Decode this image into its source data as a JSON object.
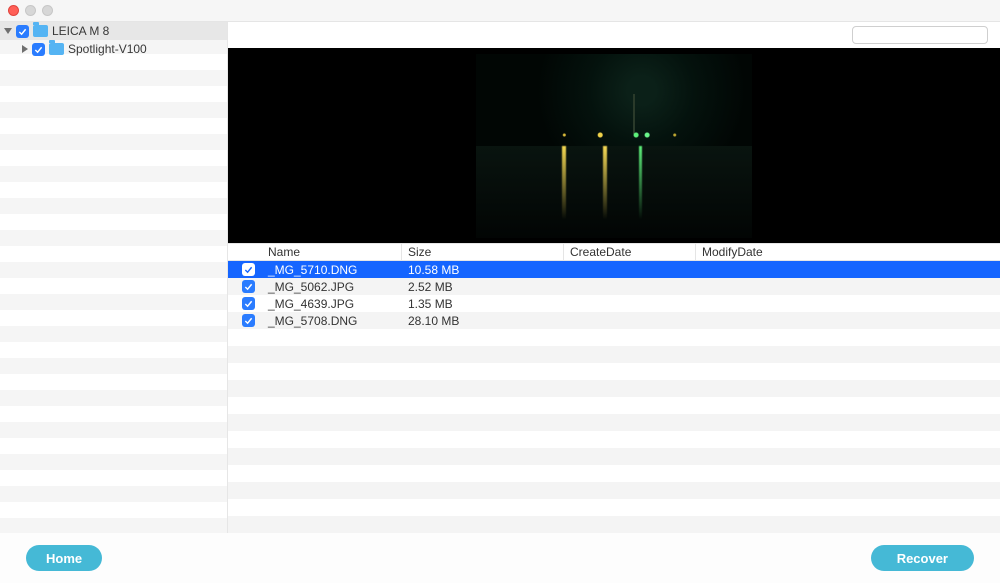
{
  "sidebar": {
    "root": {
      "label": "LEICA M 8",
      "checked": true,
      "expanded": true
    },
    "children": [
      {
        "label": "Spotlight-V100",
        "checked": true,
        "expanded": false
      }
    ]
  },
  "search": {
    "placeholder": ""
  },
  "table": {
    "headers": {
      "name": "Name",
      "size": "Size",
      "createDate": "CreateDate",
      "modifyDate": "ModifyDate"
    },
    "rows": [
      {
        "checked": true,
        "selected": true,
        "name": "_MG_5710.DNG",
        "size": "10.58 MB",
        "createDate": "",
        "modifyDate": ""
      },
      {
        "checked": true,
        "selected": false,
        "name": "_MG_5062.JPG",
        "size": "2.52 MB",
        "createDate": "",
        "modifyDate": ""
      },
      {
        "checked": true,
        "selected": false,
        "name": "_MG_4639.JPG",
        "size": "1.35 MB",
        "createDate": "",
        "modifyDate": ""
      },
      {
        "checked": true,
        "selected": false,
        "name": "_MG_5708.DNG",
        "size": "28.10 MB",
        "createDate": "",
        "modifyDate": ""
      }
    ]
  },
  "footer": {
    "home": "Home",
    "recover": "Recover"
  }
}
